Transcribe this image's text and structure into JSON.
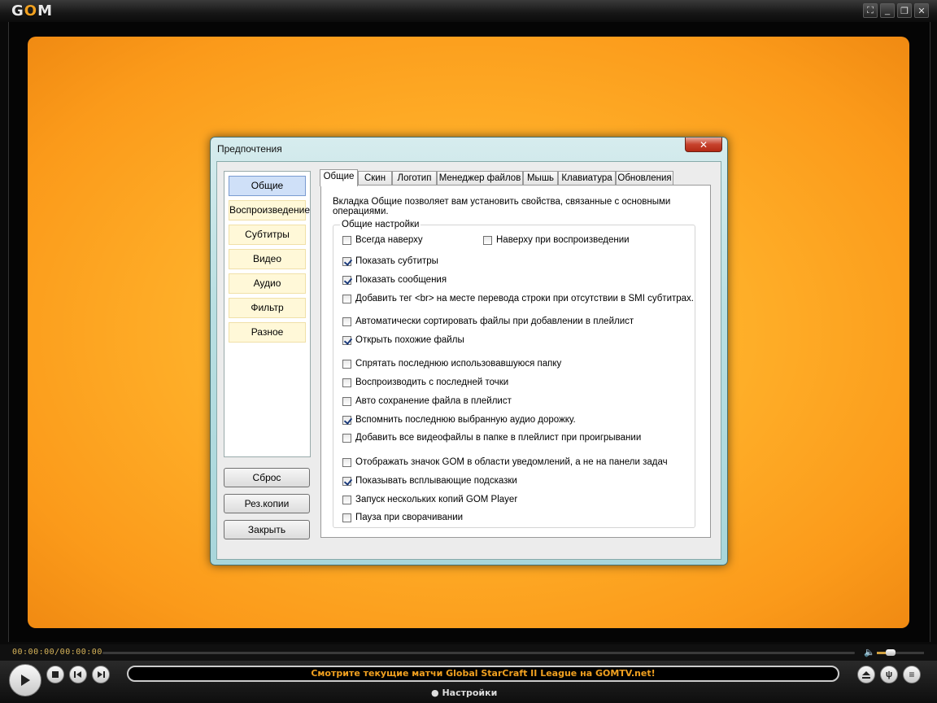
{
  "app": {
    "logo_prefix": "G",
    "logo_o": "O",
    "logo_suffix": "M",
    "window_buttons": [
      "⛶",
      "_",
      "❐",
      "✕"
    ]
  },
  "player": {
    "timecode": "00:00:00/00:00:00",
    "marquee": "Смотрите текущие матчи Global StarCraft II League на GOMTV.net!",
    "settings_label": "Настройки",
    "volume_fraction": 0.3
  },
  "dialog": {
    "title": "Предпочтения",
    "close_label": "✕",
    "categories": [
      "Общие",
      "Воспроизведение",
      "Субтитры",
      "Видео",
      "Аудио",
      "Фильтр",
      "Разное"
    ],
    "buttons": {
      "reset": "Сброс",
      "backup": "Рез.копии",
      "close": "Закрыть"
    },
    "tabs": [
      "Общие",
      "Скин",
      "Логотип",
      "Менеджер файлов",
      "Мышь",
      "Клавиатура",
      "Обновления"
    ],
    "description": "Вкладка Общие позволяет вам установить свойства, связанные с основными операциями.",
    "group_label": "Общие настройки",
    "options": [
      {
        "label": "Всегда наверху",
        "checked": false
      },
      {
        "label": "Наверху при воспроизведении",
        "checked": false
      },
      {
        "label": "Показать субтитры",
        "checked": true
      },
      {
        "label": "Показать сообщения",
        "checked": true
      },
      {
        "label": "Добавить тег <br> на месте перевода строки при отсутствии в SMI субтитрах.",
        "checked": false
      },
      {
        "label": "Автоматически сортировать файлы при добавлении в плейлист",
        "checked": false
      },
      {
        "label": "Открыть похожие файлы",
        "checked": true
      },
      {
        "label": "Спрятать последнюю использовавшуюся папку",
        "checked": false
      },
      {
        "label": "Воспроизводить с последней точки",
        "checked": false
      },
      {
        "label": "Авто сохранение файла в плейлист",
        "checked": false
      },
      {
        "label": "Вспомнить последнюю выбранную аудио дорожку.",
        "checked": true
      },
      {
        "label": "Добавить все видеофайлы в папке в плейлист при проигрывании",
        "checked": false
      },
      {
        "label": "Отображать значок GOM в области уведомлений, а не на панели задач",
        "checked": false
      },
      {
        "label": "Показывать всплывающие подсказки",
        "checked": true
      },
      {
        "label": "Запуск нескольких копий GOM Player",
        "checked": false
      },
      {
        "label": "Пауза при сворачивании",
        "checked": false
      }
    ]
  }
}
